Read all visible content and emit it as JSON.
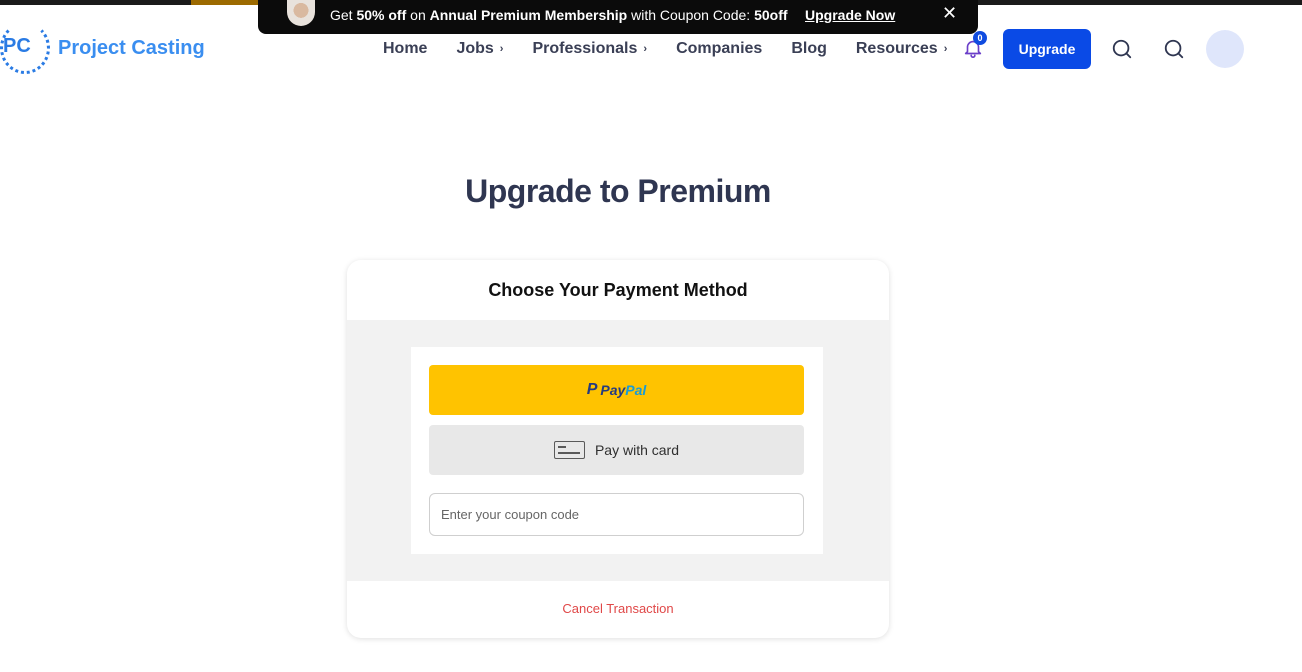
{
  "promo": {
    "prefix": "Get",
    "highlight": "50% off",
    "middle": "on",
    "product": "Annual Premium Membership",
    "suffix": "with Coupon Code:",
    "code": "50off",
    "cta": "Upgrade Now"
  },
  "header": {
    "logo_mark": "PC",
    "logo_text": "Project Casting",
    "nav": [
      {
        "label": "Home",
        "has_submenu": false
      },
      {
        "label": "Jobs",
        "has_submenu": true
      },
      {
        "label": "Professionals",
        "has_submenu": true
      },
      {
        "label": "Companies",
        "has_submenu": false
      },
      {
        "label": "Blog",
        "has_submenu": false
      },
      {
        "label": "Resources",
        "has_submenu": true
      }
    ],
    "notification_count": "0",
    "upgrade_label": "Upgrade"
  },
  "main": {
    "title": "Upgrade to Premium",
    "card": {
      "heading": "Choose Your Payment Method",
      "paypal_pay": "Pay",
      "paypal_pal": "Pal",
      "card_label": "Pay with card",
      "coupon_placeholder": "Enter your coupon code",
      "coupon_value": "",
      "cancel_label": "Cancel Transaction"
    }
  },
  "colors": {
    "brand_blue": "#0a4ae6",
    "logo_blue": "#3a8ef0",
    "paypal_yellow": "#ffc300",
    "cancel_red": "#e04848",
    "title_navy": "#2f3651"
  },
  "icons": [
    "close-icon",
    "chevron-right-icon",
    "bell-icon",
    "search-icon",
    "card-icon",
    "paypal-icon"
  ]
}
